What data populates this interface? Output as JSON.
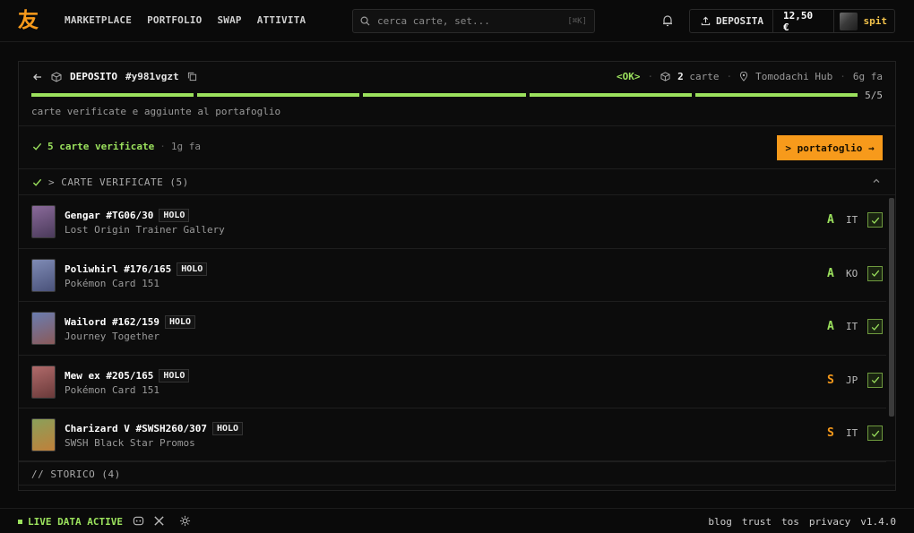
{
  "brand": {
    "logo": "友",
    "accent": "#f79a1b",
    "success": "#9be15d",
    "gold": "#f2c24b"
  },
  "nav": {
    "items": [
      "MARKETPLACE",
      "PORTFOLIO",
      "SWAP",
      "ATTIVITA"
    ]
  },
  "search": {
    "placeholder": "cerca carte, set...",
    "shortcut": "[⌘K]"
  },
  "account": {
    "deposit_label": "DEPOSITA",
    "balance": "12,50 €",
    "username": "spit"
  },
  "deposit": {
    "title": "DEPOSITO",
    "id": "#y981vgzt",
    "status": "<OK>",
    "cards_count": "2",
    "cards_label": "carte",
    "location": "Tomodachi Hub",
    "age": "6g fa",
    "progress": {
      "done": 5,
      "total": 5,
      "label": "5/5"
    },
    "progress_text": "carte verificate e aggiunte al portafoglio"
  },
  "verified": {
    "text": "5 carte verificate",
    "time": "1g fa",
    "cta": "> portafoglio →"
  },
  "section": {
    "title": "> CARTE VERIFICATE (5)"
  },
  "cards": [
    {
      "name": "Gengar #TG06/30",
      "badge": "HOLO",
      "set": "Lost Origin Trainer Gallery",
      "grade": "A",
      "grade_color": "#9be15d",
      "lang": "IT",
      "thumb": [
        "#8a6a9a",
        "#4a3a5a"
      ]
    },
    {
      "name": "Poliwhirl #176/165",
      "badge": "HOLO",
      "set": "Pokémon Card 151",
      "grade": "A",
      "grade_color": "#9be15d",
      "lang": "KO",
      "thumb": [
        "#7f8bb5",
        "#4a527a"
      ]
    },
    {
      "name": "Wailord #162/159",
      "badge": "HOLO",
      "set": "Journey Together",
      "grade": "A",
      "grade_color": "#9be15d",
      "lang": "IT",
      "thumb": [
        "#6a7db0",
        "#8a5a5a"
      ]
    },
    {
      "name": "Mew ex #205/165",
      "badge": "HOLO",
      "set": "Pokémon Card 151",
      "grade": "S",
      "grade_color": "#f79a1b",
      "lang": "JP",
      "thumb": [
        "#b06a6a",
        "#6a3a3a"
      ]
    },
    {
      "name": "Charizard V #SWSH260/307",
      "badge": "HOLO",
      "set": "SWSH Black Star Promos",
      "grade": "S",
      "grade_color": "#f79a1b",
      "lang": "IT",
      "thumb": [
        "#8aa05a",
        "#c0803a"
      ]
    }
  ],
  "history": {
    "title": "// STORICO (4)"
  },
  "footer": {
    "live": "LIVE DATA ACTIVE",
    "links": [
      "blog",
      "trust",
      "tos",
      "privacy",
      "v1.4.0"
    ]
  }
}
